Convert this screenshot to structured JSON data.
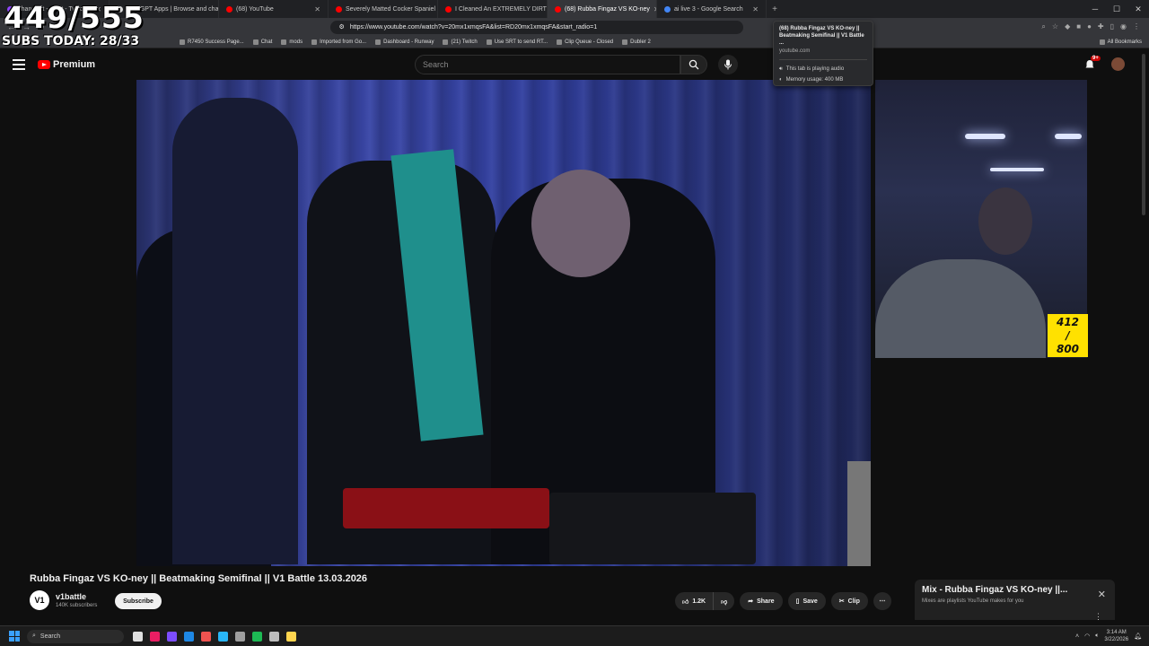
{
  "browser": {
    "tabs": [
      {
        "title": "ShaneWit - Chat - Twitch",
        "color": "#9146ff",
        "active": false
      },
      {
        "title": "ChatGPT Apps | Browse and chat with",
        "color": "#d9d9d9",
        "active": false
      },
      {
        "title": "(68) YouTube",
        "color": "#ff0000",
        "active": false
      },
      {
        "title": "Severely Matted Cocker Spaniel Mix",
        "color": "#ff0000",
        "active": false
      },
      {
        "title": "I Cleaned An EXTREMELY DIRTY Rug",
        "color": "#ff0000",
        "active": false
      },
      {
        "title": "(68) Rubba Fingaz VS KO-ney",
        "color": "#ff0000",
        "active": true
      },
      {
        "title": "ai live 3 - Google Search",
        "color": "#4285f4",
        "active": false
      }
    ],
    "url": "https://www.youtube.com/watch?v=20mx1xmqsFA&list=RD20mx1xmqsFA&start_radio=1",
    "bookmarks": [
      "R7450 Success Page...",
      "Chat",
      "mods",
      "Imported from Go...",
      "Dashboard - Runway",
      "(21) Twitch",
      "Use SRT to send RT...",
      "Clip Queue - Closed",
      "Dubler 2"
    ],
    "all_bookmarks": "All Bookmarks"
  },
  "tab_popup": {
    "title": "(68) Rubba Fingaz VS KO-ney || Beatmaking Semifinal || V1 Battle ...",
    "domain": "youtube.com",
    "audio": "This tab is playing audio",
    "memory": "Memory usage: 400 MB"
  },
  "overlay": {
    "counter": "449/555",
    "subs_today": "SUBS TODAY: 28/33",
    "cam_counter_top": "412",
    "cam_counter_mid": "/",
    "cam_counter_bottom": "800"
  },
  "youtube": {
    "brand": "Premium",
    "search_placeholder": "Search",
    "notification_count": "9+",
    "video_title": "Rubba Fingaz VS KO-ney || Beatmaking Semifinal || V1 Battle 13.03.2026",
    "channel": {
      "avatar_text": "V1",
      "name": "v1battle",
      "subscribers": "140K subscribers"
    },
    "subscribe_label": "Subscribe",
    "likes": "1.2K",
    "share_label": "Share",
    "save_label": "Save",
    "clip_label": "Clip",
    "mix": {
      "title": "Mix - Rubba Fingaz VS KO-ney ||...",
      "subtitle": "Mixes are playlists YouTube makes for you"
    }
  },
  "taskbar": {
    "search_label": "Search",
    "time": "3:14 AM",
    "date": "3/22/2026",
    "app_colors": [
      "#e0e0e0",
      "#e91e63",
      "#7c4dff",
      "#1e88e5",
      "#ef5350",
      "#29b6f6",
      "#9e9e9e",
      "#1db954",
      "#bdbdbd",
      "#ffd54f"
    ]
  },
  "colors": {
    "youtube_red": "#ff0000",
    "cam_counter_bg": "#ffe100"
  }
}
